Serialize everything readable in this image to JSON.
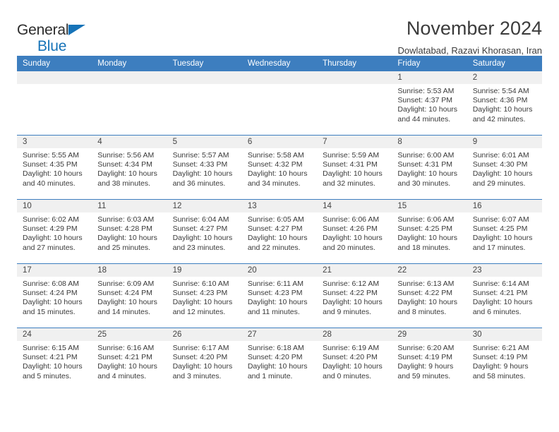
{
  "brand": {
    "name_top": "General",
    "name_bottom": "Blue",
    "accent_color": "#1673b8"
  },
  "header": {
    "title": "November 2024",
    "subtitle": "Dowlatabad, Razavi Khorasan, Iran"
  },
  "calendar": {
    "header_color": "#3d7ebf",
    "daynum_background": "#f0f0f0",
    "weekdays": [
      "Sunday",
      "Monday",
      "Tuesday",
      "Wednesday",
      "Thursday",
      "Friday",
      "Saturday"
    ],
    "weeks": [
      [
        {
          "day": "",
          "sunrise": "",
          "sunset": "",
          "daylight": ""
        },
        {
          "day": "",
          "sunrise": "",
          "sunset": "",
          "daylight": ""
        },
        {
          "day": "",
          "sunrise": "",
          "sunset": "",
          "daylight": ""
        },
        {
          "day": "",
          "sunrise": "",
          "sunset": "",
          "daylight": ""
        },
        {
          "day": "",
          "sunrise": "",
          "sunset": "",
          "daylight": ""
        },
        {
          "day": "1",
          "sunrise": "Sunrise: 5:53 AM",
          "sunset": "Sunset: 4:37 PM",
          "daylight": "Daylight: 10 hours and 44 minutes."
        },
        {
          "day": "2",
          "sunrise": "Sunrise: 5:54 AM",
          "sunset": "Sunset: 4:36 PM",
          "daylight": "Daylight: 10 hours and 42 minutes."
        }
      ],
      [
        {
          "day": "3",
          "sunrise": "Sunrise: 5:55 AM",
          "sunset": "Sunset: 4:35 PM",
          "daylight": "Daylight: 10 hours and 40 minutes."
        },
        {
          "day": "4",
          "sunrise": "Sunrise: 5:56 AM",
          "sunset": "Sunset: 4:34 PM",
          "daylight": "Daylight: 10 hours and 38 minutes."
        },
        {
          "day": "5",
          "sunrise": "Sunrise: 5:57 AM",
          "sunset": "Sunset: 4:33 PM",
          "daylight": "Daylight: 10 hours and 36 minutes."
        },
        {
          "day": "6",
          "sunrise": "Sunrise: 5:58 AM",
          "sunset": "Sunset: 4:32 PM",
          "daylight": "Daylight: 10 hours and 34 minutes."
        },
        {
          "day": "7",
          "sunrise": "Sunrise: 5:59 AM",
          "sunset": "Sunset: 4:31 PM",
          "daylight": "Daylight: 10 hours and 32 minutes."
        },
        {
          "day": "8",
          "sunrise": "Sunrise: 6:00 AM",
          "sunset": "Sunset: 4:31 PM",
          "daylight": "Daylight: 10 hours and 30 minutes."
        },
        {
          "day": "9",
          "sunrise": "Sunrise: 6:01 AM",
          "sunset": "Sunset: 4:30 PM",
          "daylight": "Daylight: 10 hours and 29 minutes."
        }
      ],
      [
        {
          "day": "10",
          "sunrise": "Sunrise: 6:02 AM",
          "sunset": "Sunset: 4:29 PM",
          "daylight": "Daylight: 10 hours and 27 minutes."
        },
        {
          "day": "11",
          "sunrise": "Sunrise: 6:03 AM",
          "sunset": "Sunset: 4:28 PM",
          "daylight": "Daylight: 10 hours and 25 minutes."
        },
        {
          "day": "12",
          "sunrise": "Sunrise: 6:04 AM",
          "sunset": "Sunset: 4:27 PM",
          "daylight": "Daylight: 10 hours and 23 minutes."
        },
        {
          "day": "13",
          "sunrise": "Sunrise: 6:05 AM",
          "sunset": "Sunset: 4:27 PM",
          "daylight": "Daylight: 10 hours and 22 minutes."
        },
        {
          "day": "14",
          "sunrise": "Sunrise: 6:06 AM",
          "sunset": "Sunset: 4:26 PM",
          "daylight": "Daylight: 10 hours and 20 minutes."
        },
        {
          "day": "15",
          "sunrise": "Sunrise: 6:06 AM",
          "sunset": "Sunset: 4:25 PM",
          "daylight": "Daylight: 10 hours and 18 minutes."
        },
        {
          "day": "16",
          "sunrise": "Sunrise: 6:07 AM",
          "sunset": "Sunset: 4:25 PM",
          "daylight": "Daylight: 10 hours and 17 minutes."
        }
      ],
      [
        {
          "day": "17",
          "sunrise": "Sunrise: 6:08 AM",
          "sunset": "Sunset: 4:24 PM",
          "daylight": "Daylight: 10 hours and 15 minutes."
        },
        {
          "day": "18",
          "sunrise": "Sunrise: 6:09 AM",
          "sunset": "Sunset: 4:24 PM",
          "daylight": "Daylight: 10 hours and 14 minutes."
        },
        {
          "day": "19",
          "sunrise": "Sunrise: 6:10 AM",
          "sunset": "Sunset: 4:23 PM",
          "daylight": "Daylight: 10 hours and 12 minutes."
        },
        {
          "day": "20",
          "sunrise": "Sunrise: 6:11 AM",
          "sunset": "Sunset: 4:23 PM",
          "daylight": "Daylight: 10 hours and 11 minutes."
        },
        {
          "day": "21",
          "sunrise": "Sunrise: 6:12 AM",
          "sunset": "Sunset: 4:22 PM",
          "daylight": "Daylight: 10 hours and 9 minutes."
        },
        {
          "day": "22",
          "sunrise": "Sunrise: 6:13 AM",
          "sunset": "Sunset: 4:22 PM",
          "daylight": "Daylight: 10 hours and 8 minutes."
        },
        {
          "day": "23",
          "sunrise": "Sunrise: 6:14 AM",
          "sunset": "Sunset: 4:21 PM",
          "daylight": "Daylight: 10 hours and 6 minutes."
        }
      ],
      [
        {
          "day": "24",
          "sunrise": "Sunrise: 6:15 AM",
          "sunset": "Sunset: 4:21 PM",
          "daylight": "Daylight: 10 hours and 5 minutes."
        },
        {
          "day": "25",
          "sunrise": "Sunrise: 6:16 AM",
          "sunset": "Sunset: 4:21 PM",
          "daylight": "Daylight: 10 hours and 4 minutes."
        },
        {
          "day": "26",
          "sunrise": "Sunrise: 6:17 AM",
          "sunset": "Sunset: 4:20 PM",
          "daylight": "Daylight: 10 hours and 3 minutes."
        },
        {
          "day": "27",
          "sunrise": "Sunrise: 6:18 AM",
          "sunset": "Sunset: 4:20 PM",
          "daylight": "Daylight: 10 hours and 1 minute."
        },
        {
          "day": "28",
          "sunrise": "Sunrise: 6:19 AM",
          "sunset": "Sunset: 4:20 PM",
          "daylight": "Daylight: 10 hours and 0 minutes."
        },
        {
          "day": "29",
          "sunrise": "Sunrise: 6:20 AM",
          "sunset": "Sunset: 4:19 PM",
          "daylight": "Daylight: 9 hours and 59 minutes."
        },
        {
          "day": "30",
          "sunrise": "Sunrise: 6:21 AM",
          "sunset": "Sunset: 4:19 PM",
          "daylight": "Daylight: 9 hours and 58 minutes."
        }
      ]
    ]
  }
}
